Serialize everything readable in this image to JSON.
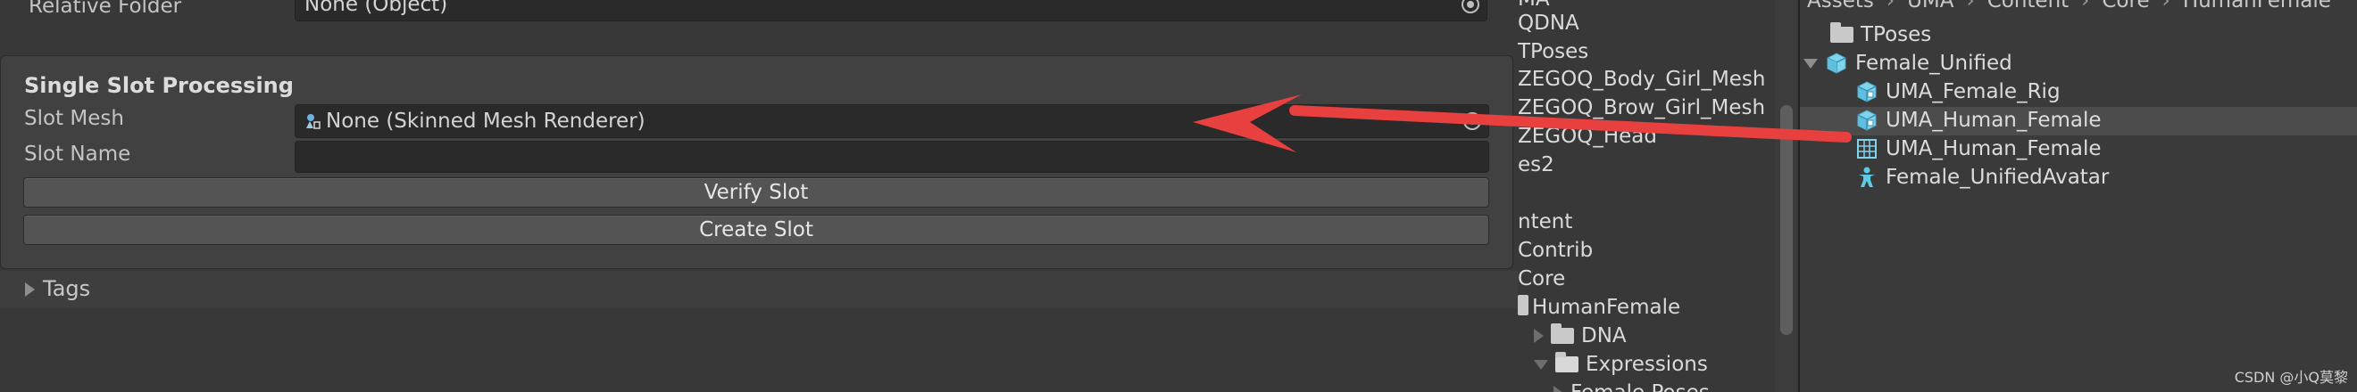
{
  "inspector": {
    "relative_folder_label": "Relative Folder",
    "relative_folder_value": "None (Object)",
    "section_title": "Single Slot Processing",
    "slot_mesh_label": "Slot Mesh",
    "slot_mesh_value": "None (Skinned Mesh Renderer)",
    "slot_name_label": "Slot Name",
    "slot_name_value": "",
    "verify_button": "Verify Slot",
    "create_button": "Create Slot",
    "tags_label": "Tags"
  },
  "tree": {
    "items": [
      "MA",
      "QDNA",
      "TPoses",
      "ZEGOQ_Body_Girl_Mesh",
      "ZEGOQ_Brow_Girl_Mesh",
      "ZEGOQ_Head",
      "es2",
      "ntent",
      "Contrib",
      "Core",
      "HumanFemale",
      "DNA",
      "Expressions",
      "Female Poses"
    ]
  },
  "breadcrumb": [
    "Assets",
    "UMA",
    "Content",
    "Core",
    "HumanFemale"
  ],
  "assets": {
    "items": [
      {
        "label": "TPoses",
        "icon": "folder-icon"
      },
      {
        "label": "Female_Unified",
        "icon": "prefab-cube-icon"
      },
      {
        "label": "UMA_Female_Rig",
        "icon": "prefab-cube-icon"
      },
      {
        "label": "UMA_Human_Female",
        "icon": "prefab-cube-icon"
      },
      {
        "label": "UMA_Human_Female",
        "icon": "mesh-grid-icon"
      },
      {
        "label": "Female_UnifiedAvatar",
        "icon": "avatar-figure-icon"
      }
    ]
  },
  "annotation": {
    "arrow_color": "#e8403f"
  },
  "watermark": "CSDN @小Q莫黎",
  "colors": {
    "accent_selected_row": "#4c4c4c",
    "icon_cyan": "#5ecbe6"
  }
}
